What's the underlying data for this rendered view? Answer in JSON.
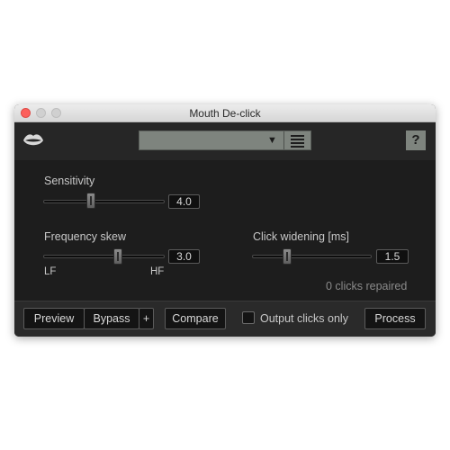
{
  "window": {
    "title": "Mouth De-click"
  },
  "header": {
    "preset_value": "",
    "help_label": "?"
  },
  "controls": {
    "sensitivity": {
      "label": "Sensitivity",
      "value": "4.0",
      "level": 0.38
    },
    "frequency_skew": {
      "label": "Frequency skew",
      "value": "3.0",
      "level": 0.62,
      "min_label": "LF",
      "max_label": "HF"
    },
    "click_widening": {
      "label": "Click widening [ms]",
      "value": "1.5",
      "level": 0.28
    }
  },
  "status": {
    "text": "0 clicks repaired"
  },
  "footer": {
    "preview": "Preview",
    "bypass": "Bypass",
    "plus": "+",
    "compare": "Compare",
    "output_clicks_only": "Output clicks only",
    "process": "Process"
  },
  "colors": {
    "background": "#1d1d1d",
    "preset_bg": "#7e847e",
    "close_button": "#fc605c"
  },
  "icons": {
    "logo": "lips-icon",
    "preset_dropdown": "chevron-down-icon",
    "preset_menu": "list-icon"
  }
}
